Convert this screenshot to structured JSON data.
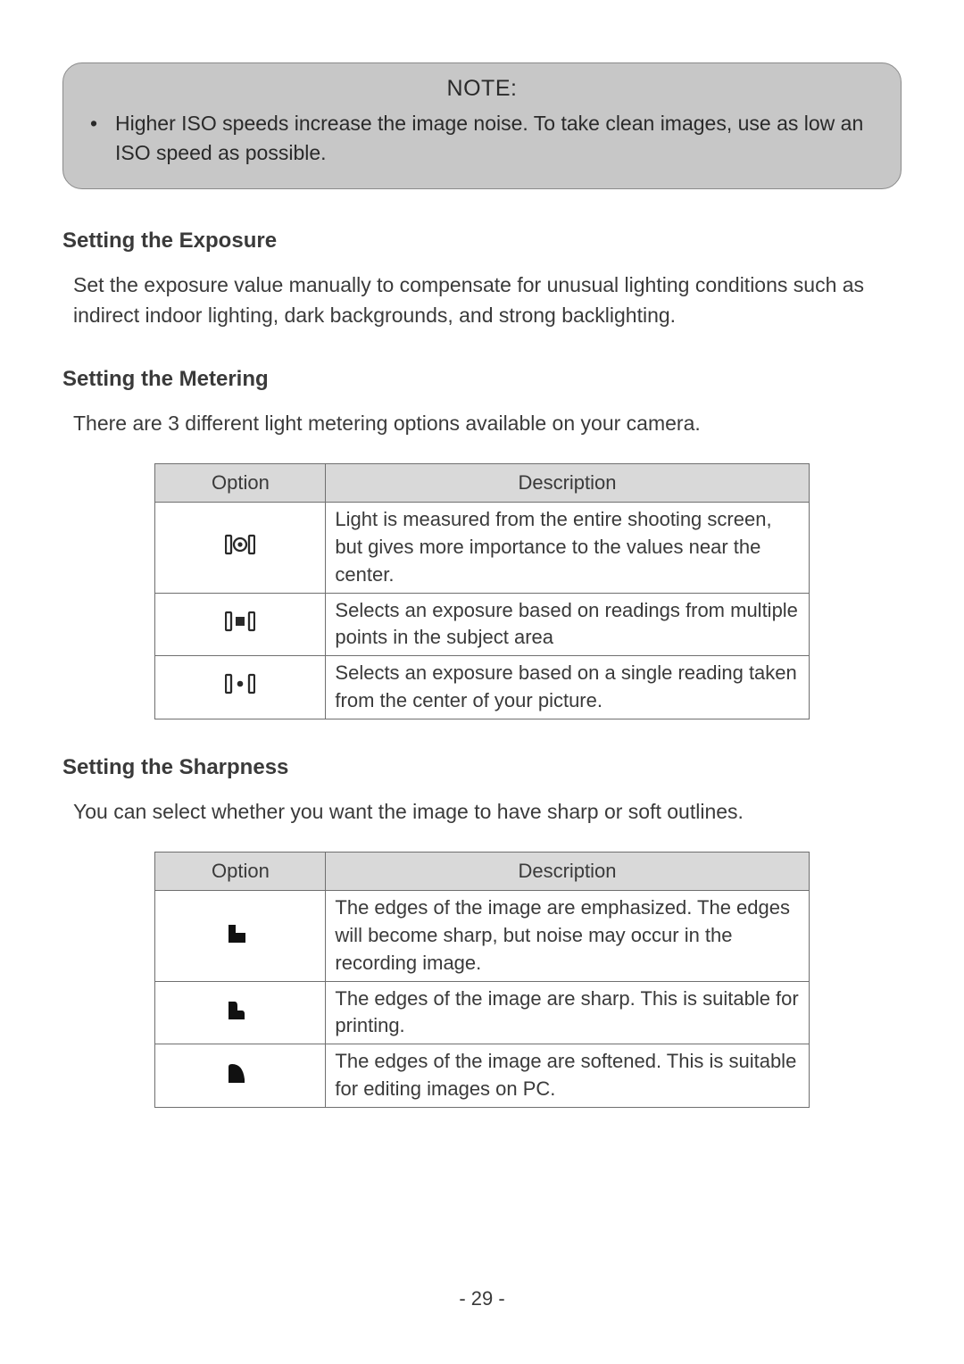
{
  "note": {
    "title": "NOTE:",
    "items": [
      "Higher ISO speeds increase the image noise. To take clean images, use as low an ISO speed as possible."
    ]
  },
  "sections": {
    "exposure": {
      "heading": "Setting the Exposure",
      "para": "Set the exposure value manually to compensate for unusual lighting conditions such as indirect indoor lighting, dark backgrounds, and strong backlighting."
    },
    "metering": {
      "heading": "Setting the Metering",
      "para": "There are 3 different light metering options available on your camera.",
      "table": {
        "headers": [
          "Option",
          "Description"
        ],
        "rows": [
          {
            "icon": "metering-center-weighted",
            "desc": "Light is measured from the entire shooting screen, but gives more importance to the values near the center."
          },
          {
            "icon": "metering-multi",
            "desc": "Selects an exposure based on readings from multiple points in the subject area"
          },
          {
            "icon": "metering-spot",
            "desc": "Selects an exposure based on a single reading taken from the center of your picture."
          }
        ]
      }
    },
    "sharpness": {
      "heading": "Setting the Sharpness",
      "para": "You can select whether you want the image to have sharp or soft outlines.",
      "table": {
        "headers": [
          "Option",
          "Description"
        ],
        "rows": [
          {
            "icon": "sharpness-high",
            "desc": "The edges of the image are emphasized. The edges will become sharp, but noise may occur in the recording image."
          },
          {
            "icon": "sharpness-normal",
            "desc": "The edges of the image are sharp. This is suitable for printing."
          },
          {
            "icon": "sharpness-soft",
            "desc": "The edges of the image are softened. This is suitable for editing images on PC."
          }
        ]
      }
    }
  },
  "page_number": "- 29 -"
}
